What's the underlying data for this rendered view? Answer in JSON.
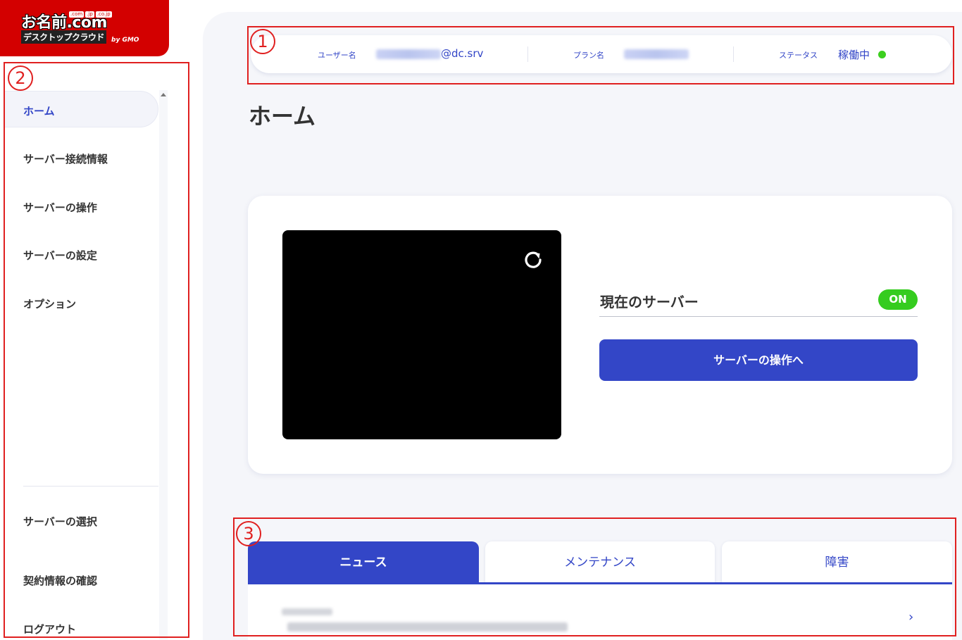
{
  "logo": {
    "brand": "お名前.com",
    "tlds": [
      ".com",
      ".jp",
      ".co.jp"
    ],
    "product": "デスクトップクラウド",
    "by": "by GMO"
  },
  "sidebar": {
    "items": [
      {
        "label": "ホーム",
        "active": true
      },
      {
        "label": "サーバー接続情報"
      },
      {
        "label": "サーバーの操作"
      },
      {
        "label": "サーバーの設定"
      },
      {
        "label": "オプション"
      },
      {
        "label": "サーバーの選択"
      },
      {
        "label": "契約情報の確認"
      },
      {
        "label": "ログアウト"
      }
    ]
  },
  "infobar": {
    "user_label": "ユーザー名",
    "user_suffix": "@dc.srv",
    "plan_label": "プラン名",
    "status_label": "ステータス",
    "status_value": "稼働中",
    "status_color": "#3ccf1f"
  },
  "page": {
    "title": "ホーム"
  },
  "server_card": {
    "current_label": "現在のサーバー",
    "state_badge": "ON",
    "action_button": "サーバーの操作へ",
    "refresh_icon": "refresh-icon"
  },
  "tabs": [
    {
      "label": "ニュース",
      "active": true
    },
    {
      "label": "メンテナンス"
    },
    {
      "label": "障害"
    }
  ],
  "annotations": [
    "1",
    "2",
    "3"
  ],
  "colors": {
    "accent": "#3346c7",
    "brand_red": "#d30000",
    "annotation": "#e02020"
  }
}
